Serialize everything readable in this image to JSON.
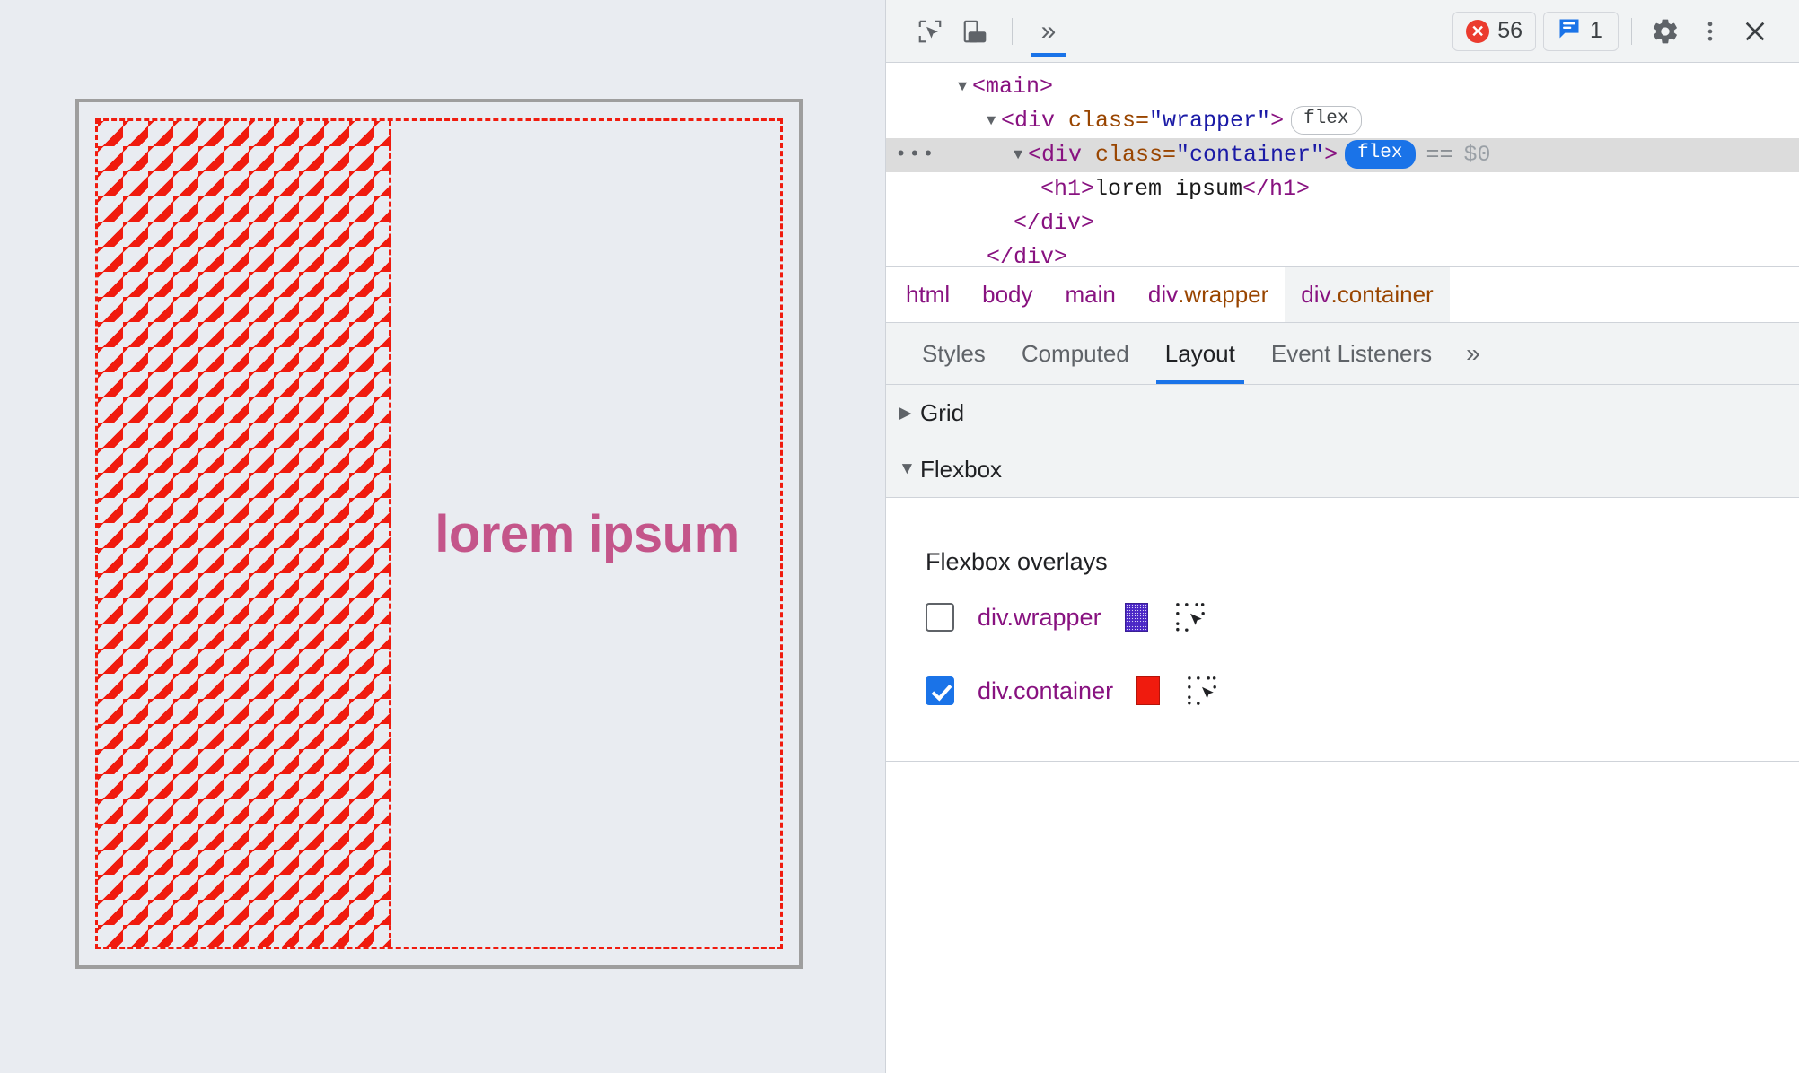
{
  "page": {
    "heading": "lorem ipsum"
  },
  "toolbar": {
    "inspect_icon": "inspect-cursor-icon",
    "device_icon": "device-toolbar-icon",
    "more_tabs": "»",
    "errors_count": "56",
    "warnings_count": "1",
    "settings_icon": "gear-icon",
    "menu_icon": "kebab-menu-icon",
    "close_icon": "close-icon"
  },
  "dom_tree": {
    "rows": [
      {
        "triangle": "▼",
        "open": "<main>",
        "chip": "",
        "suffix": ""
      },
      {
        "triangle": "▼",
        "tag_open": "<div ",
        "attr_name": "class=",
        "attr_value": "\"wrapper\"",
        "tag_close": ">",
        "chip": "flex"
      },
      {
        "triangle": "▼",
        "tag_open": "<div ",
        "attr_name": "class=",
        "attr_value": "\"container\"",
        "tag_close": ">",
        "chip": "flex",
        "eqeq": "==",
        "dollar": "$0",
        "ellipsis": "•••"
      },
      {
        "h1_open": "<h1>",
        "h1_text": "lorem ipsum",
        "h1_close": "</h1>"
      },
      {
        "close": "</div>"
      },
      {
        "close": "</div>"
      }
    ]
  },
  "breadcrumbs": [
    {
      "tag": "html",
      "cls": ""
    },
    {
      "tag": "body",
      "cls": ""
    },
    {
      "tag": "main",
      "cls": ""
    },
    {
      "tag": "div",
      "cls": ".wrapper"
    },
    {
      "tag": "div",
      "cls": ".container",
      "selected": true
    }
  ],
  "panel_tabs": {
    "tabs": [
      "Styles",
      "Computed",
      "Layout",
      "Event Listeners"
    ],
    "active": "Layout",
    "more": "»"
  },
  "layout_panel": {
    "grid": {
      "label": "Grid",
      "triangle": "▶",
      "expanded": false
    },
    "flexbox": {
      "label": "Flexbox",
      "triangle": "▼",
      "expanded": true
    },
    "overlays_title": "Flexbox overlays",
    "overlays": [
      {
        "label": "div.wrapper",
        "checked": false,
        "color": "#4b27c6",
        "pick_icon": "select-element-icon"
      },
      {
        "label": "div.container",
        "checked": true,
        "color": "#f01b0e",
        "pick_icon": "select-element-icon"
      }
    ]
  },
  "colors": {
    "accent": "#1a73e8",
    "error": "#eb3b2e",
    "overlay_container": "#f01b0e",
    "overlay_wrapper": "#4b27c6",
    "heading": "#c4558a",
    "page_background": "#e9ecf1"
  }
}
